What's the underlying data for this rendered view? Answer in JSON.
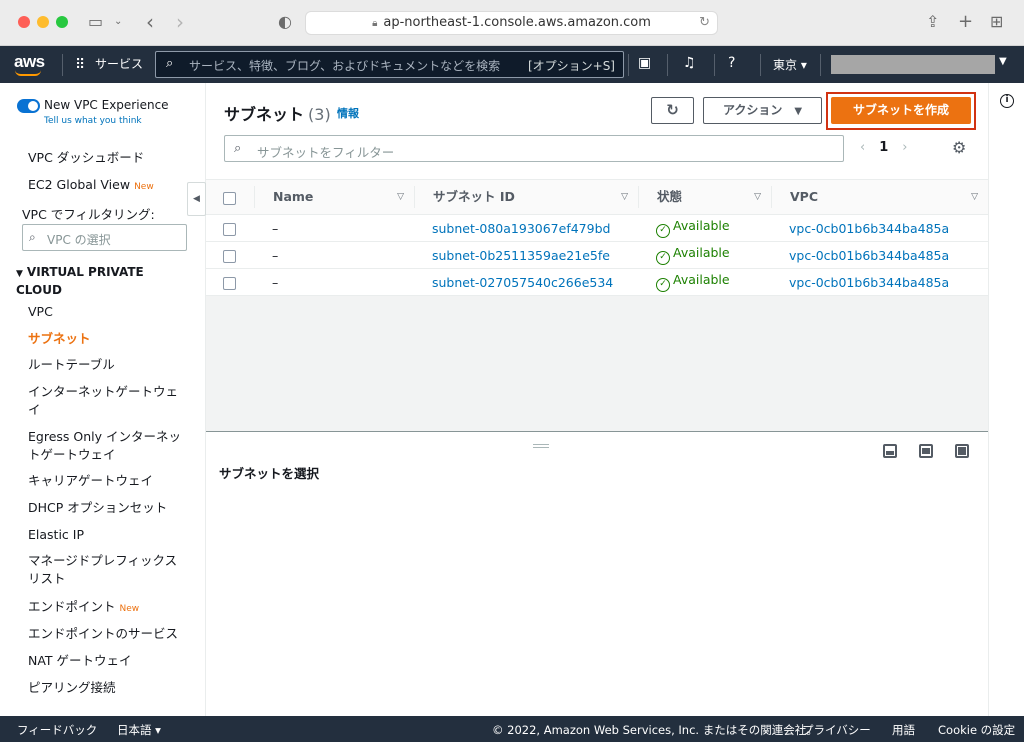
{
  "browser": {
    "url": "ap-northeast-1.console.aws.amazon.com"
  },
  "topnav": {
    "logo": "aws",
    "services": "サービス",
    "search_placeholder": "サービス、特徴、ブログ、およびドキュメントなどを検索",
    "search_hint": "[オプション+S]",
    "region": "東京 ▾"
  },
  "sidebar": {
    "toggle_label": "New VPC Experience",
    "toggle_sub": "Tell us what you think",
    "dashboard": "VPC ダッシュボード",
    "ec2_global": "EC2 Global View",
    "new_badge": "New",
    "filter_label": "VPC でフィルタリング:",
    "filter_placeholder": "VPC の選択",
    "section": "VIRTUAL PRIVATE CLOUD",
    "items": [
      "VPC",
      "サブネット",
      "ルートテーブル",
      "インターネットゲートウェイ",
      "Egress Only インターネットゲートウェイ",
      "キャリアゲートウェイ",
      "DHCP オプションセット",
      "Elastic IP",
      "マネージドプレフィックスリスト",
      "エンドポイント",
      "エンドポイントのサービス",
      "NAT ゲートウェイ",
      "ピアリング接続"
    ]
  },
  "main": {
    "title": "サブネット",
    "count": "(3)",
    "info": "情報",
    "actions_label": "アクション",
    "create_label": "サブネットを作成",
    "filter_placeholder": "サブネットをフィルター",
    "page": "1",
    "columns": [
      "Name",
      "サブネット ID",
      "状態",
      "VPC"
    ],
    "rows": [
      {
        "name": "–",
        "subnet_id": "subnet-080a193067ef479bd",
        "state": "Available",
        "vpc": "vpc-0cb01b6b344ba485a"
      },
      {
        "name": "–",
        "subnet_id": "subnet-0b2511359ae21e5fe",
        "state": "Available",
        "vpc": "vpc-0cb01b6b344ba485a"
      },
      {
        "name": "–",
        "subnet_id": "subnet-027057540c266e534",
        "state": "Available",
        "vpc": "vpc-0cb01b6b344ba485a"
      }
    ],
    "detail_title": "サブネットを選択"
  },
  "footer": {
    "feedback": "フィードバック",
    "language": "日本語 ▾",
    "copyright": "© 2022, Amazon Web Services, Inc. またはその関連会社。",
    "privacy": "プライバシー",
    "terms": "用語",
    "cookie": "Cookie の設定"
  },
  "colors": {
    "accent": "#ec7211",
    "link": "#0073bb",
    "nav_bg": "#232f3e",
    "available": "#1d8102",
    "highlight": "#d13212"
  }
}
